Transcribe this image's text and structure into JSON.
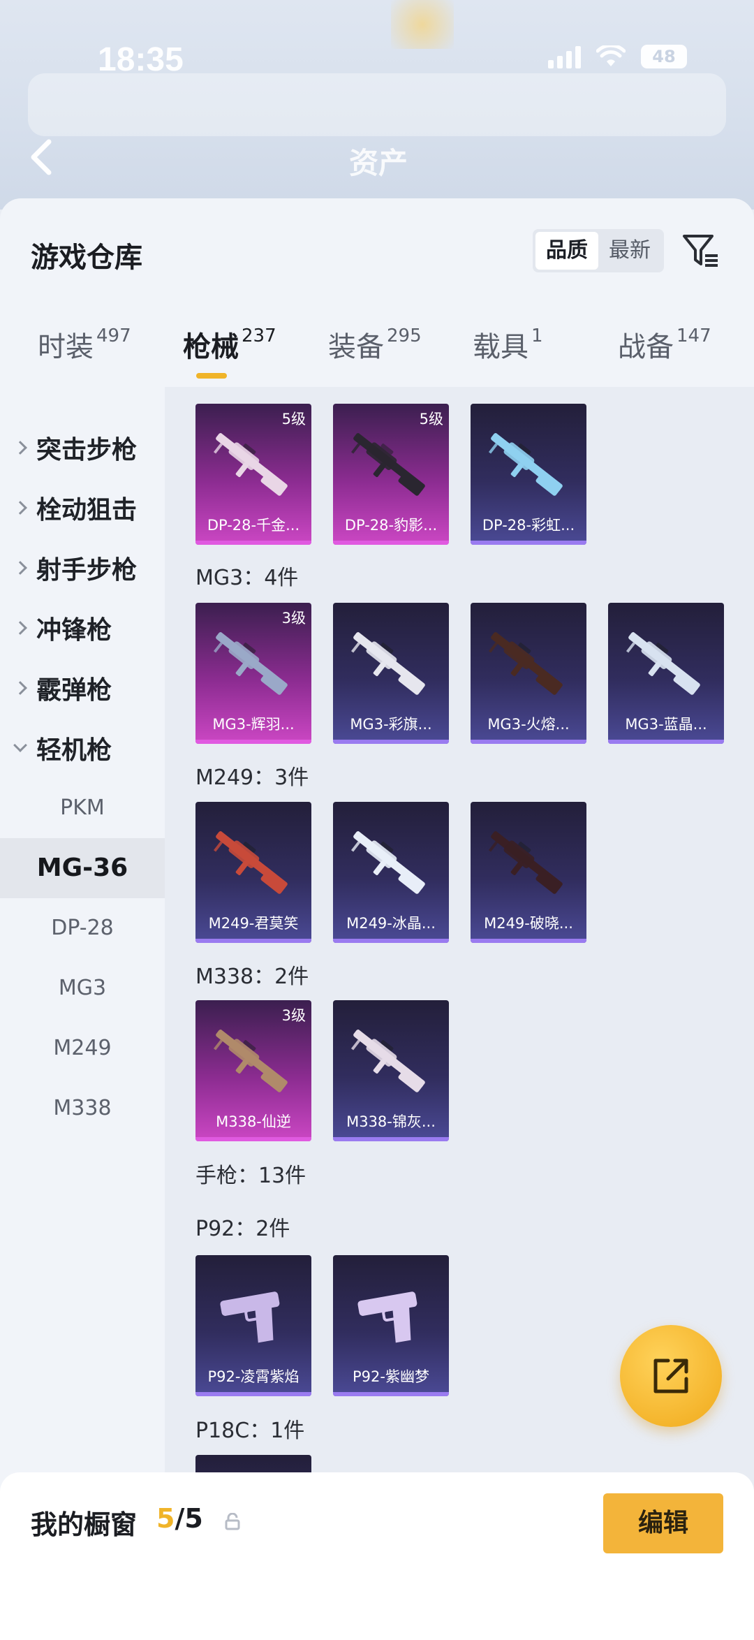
{
  "status_bar": {
    "time": "18:35",
    "battery": "48"
  },
  "header": {
    "title": "资产"
  },
  "sheet": {
    "title": "游戏仓库",
    "sort_options": [
      {
        "label": "品质",
        "active": true
      },
      {
        "label": "最新",
        "active": false
      }
    ]
  },
  "tabs": [
    {
      "label": "时装",
      "count": "497",
      "active": false
    },
    {
      "label": "枪械",
      "count": "237",
      "active": true
    },
    {
      "label": "装备",
      "count": "295",
      "active": false
    },
    {
      "label": "载具",
      "count": "1",
      "active": false
    },
    {
      "label": "战备",
      "count": "147",
      "active": false
    }
  ],
  "sidebar": {
    "categories": [
      {
        "label": "突击步枪",
        "expanded": false
      },
      {
        "label": "栓动狙击",
        "expanded": false
      },
      {
        "label": "射手步枪",
        "expanded": false
      },
      {
        "label": "冲锋枪",
        "expanded": false
      },
      {
        "label": "霰弹枪",
        "expanded": false
      },
      {
        "label": "轻机枪",
        "expanded": true
      }
    ],
    "subitems": [
      {
        "label": "PKM",
        "active": false
      },
      {
        "label": "MG-36",
        "active": true
      },
      {
        "label": "DP-28",
        "active": false
      },
      {
        "label": "MG3",
        "active": false
      },
      {
        "label": "M249",
        "active": false
      },
      {
        "label": "M338",
        "active": false
      }
    ]
  },
  "sections": [
    {
      "label": "MG3：4件"
    },
    {
      "label": "M249：3件"
    },
    {
      "label": "M338：2件"
    },
    {
      "label": "手枪：13件"
    },
    {
      "label": "P92：2件"
    },
    {
      "label": "P18C：1件"
    }
  ],
  "items": [
    {
      "name": "DP-28-千金...",
      "level": "5级",
      "rarity": "legendary"
    },
    {
      "name": "DP-28-豹影...",
      "level": "5级",
      "rarity": "legendary"
    },
    {
      "name": "DP-28-彩虹...",
      "level": "",
      "rarity": "epic"
    },
    {
      "name": "MG3-辉羽...",
      "level": "3级",
      "rarity": "legendary"
    },
    {
      "name": "MG3-彩旗...",
      "level": "",
      "rarity": "epic"
    },
    {
      "name": "MG3-火熔...",
      "level": "",
      "rarity": "epic"
    },
    {
      "name": "MG3-蓝晶...",
      "level": "",
      "rarity": "epic"
    },
    {
      "name": "M249-君莫笑",
      "level": "",
      "rarity": "epic"
    },
    {
      "name": "M249-冰晶...",
      "level": "",
      "rarity": "epic"
    },
    {
      "name": "M249-破晓...",
      "level": "",
      "rarity": "epic"
    },
    {
      "name": "M338-仙逆",
      "level": "3级",
      "rarity": "legendary"
    },
    {
      "name": "M338-锦灰...",
      "level": "",
      "rarity": "epic"
    },
    {
      "name": "P92-凌霄紫焰",
      "level": "",
      "rarity": "epic"
    },
    {
      "name": "P92-紫幽梦",
      "level": "",
      "rarity": "epic"
    },
    {
      "name": "",
      "level": "",
      "rarity": "epic"
    }
  ],
  "showcase": {
    "label": "我的橱窗",
    "current": "5",
    "total": "/5",
    "edit_label": "编辑"
  },
  "colors": {
    "accent": "#f0b429",
    "legendary": "#cc47c4",
    "epic": "#4b4a96",
    "sheet_bg": "#f1f4f9"
  },
  "icons": [
    "back-arrow-icon",
    "filter-icon",
    "share-icon",
    "lock-icon",
    "chevron-right-icon",
    "chevron-down-icon",
    "signal-icon",
    "wifi-icon",
    "battery-icon"
  ]
}
